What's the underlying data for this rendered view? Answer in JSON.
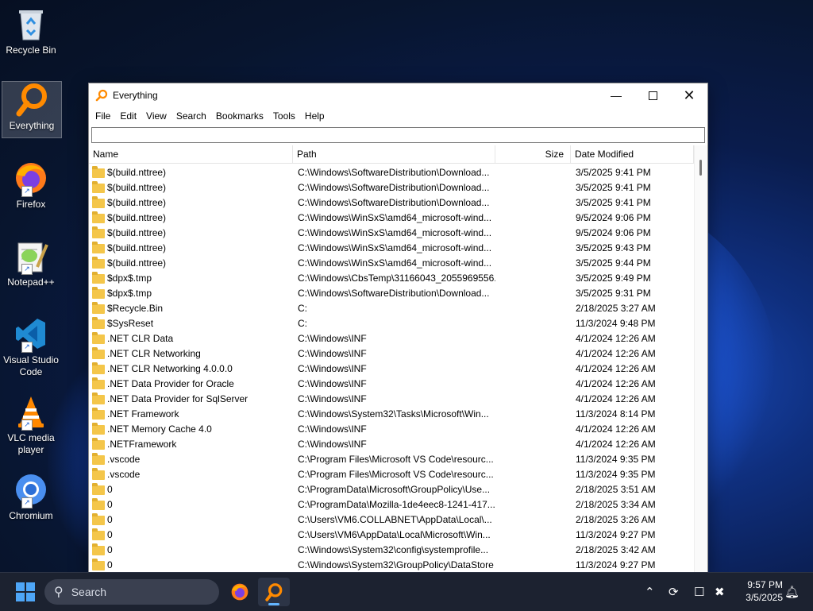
{
  "desktop": {
    "icons": [
      {
        "label": "Recycle Bin",
        "icon": "recycle-bin-icon"
      },
      {
        "label": "Everything",
        "icon": "everything-icon"
      },
      {
        "label": "Firefox",
        "icon": "firefox-icon"
      },
      {
        "label": "Notepad++",
        "icon": "notepadpp-icon"
      },
      {
        "label": "Visual Studio Code",
        "icon": "vscode-icon"
      },
      {
        "label": "VLC media player",
        "icon": "vlc-icon"
      },
      {
        "label": "Chromium",
        "icon": "chromium-icon"
      }
    ]
  },
  "window": {
    "title": "Everything",
    "menu": [
      "File",
      "Edit",
      "View",
      "Search",
      "Bookmarks",
      "Tools",
      "Help"
    ],
    "search_value": "",
    "columns": {
      "name": "Name",
      "path": "Path",
      "size": "Size",
      "date": "Date Modified"
    },
    "rows": [
      {
        "name": "$(build.nttree)",
        "path": "C:\\Windows\\SoftwareDistribution\\Download...",
        "size": "",
        "date": "3/5/2025 9:41 PM"
      },
      {
        "name": "$(build.nttree)",
        "path": "C:\\Windows\\SoftwareDistribution\\Download...",
        "size": "",
        "date": "3/5/2025 9:41 PM"
      },
      {
        "name": "$(build.nttree)",
        "path": "C:\\Windows\\SoftwareDistribution\\Download...",
        "size": "",
        "date": "3/5/2025 9:41 PM"
      },
      {
        "name": "$(build.nttree)",
        "path": "C:\\Windows\\WinSxS\\amd64_microsoft-wind...",
        "size": "",
        "date": "9/5/2024 9:06 PM"
      },
      {
        "name": "$(build.nttree)",
        "path": "C:\\Windows\\WinSxS\\amd64_microsoft-wind...",
        "size": "",
        "date": "9/5/2024 9:06 PM"
      },
      {
        "name": "$(build.nttree)",
        "path": "C:\\Windows\\WinSxS\\amd64_microsoft-wind...",
        "size": "",
        "date": "3/5/2025 9:43 PM"
      },
      {
        "name": "$(build.nttree)",
        "path": "C:\\Windows\\WinSxS\\amd64_microsoft-wind...",
        "size": "",
        "date": "3/5/2025 9:44 PM"
      },
      {
        "name": "$dpx$.tmp",
        "path": "C:\\Windows\\CbsTemp\\31166043_2055969556...",
        "size": "",
        "date": "3/5/2025 9:49 PM"
      },
      {
        "name": "$dpx$.tmp",
        "path": "C:\\Windows\\SoftwareDistribution\\Download...",
        "size": "",
        "date": "3/5/2025 9:31 PM"
      },
      {
        "name": "$Recycle.Bin",
        "path": "C:",
        "size": "",
        "date": "2/18/2025 3:27 AM"
      },
      {
        "name": "$SysReset",
        "path": "C:",
        "size": "",
        "date": "11/3/2024 9:48 PM"
      },
      {
        "name": ".NET CLR Data",
        "path": "C:\\Windows\\INF",
        "size": "",
        "date": "4/1/2024 12:26 AM"
      },
      {
        "name": ".NET CLR Networking",
        "path": "C:\\Windows\\INF",
        "size": "",
        "date": "4/1/2024 12:26 AM"
      },
      {
        "name": ".NET CLR Networking 4.0.0.0",
        "path": "C:\\Windows\\INF",
        "size": "",
        "date": "4/1/2024 12:26 AM"
      },
      {
        "name": ".NET Data Provider for Oracle",
        "path": "C:\\Windows\\INF",
        "size": "",
        "date": "4/1/2024 12:26 AM"
      },
      {
        "name": ".NET Data Provider for SqlServer",
        "path": "C:\\Windows\\INF",
        "size": "",
        "date": "4/1/2024 12:26 AM"
      },
      {
        "name": ".NET Framework",
        "path": "C:\\Windows\\System32\\Tasks\\Microsoft\\Win...",
        "size": "",
        "date": "11/3/2024 8:14 PM"
      },
      {
        "name": ".NET Memory Cache 4.0",
        "path": "C:\\Windows\\INF",
        "size": "",
        "date": "4/1/2024 12:26 AM"
      },
      {
        "name": ".NETFramework",
        "path": "C:\\Windows\\INF",
        "size": "",
        "date": "4/1/2024 12:26 AM"
      },
      {
        "name": ".vscode",
        "path": "C:\\Program Files\\Microsoft VS Code\\resourc...",
        "size": "",
        "date": "11/3/2024 9:35 PM"
      },
      {
        "name": ".vscode",
        "path": "C:\\Program Files\\Microsoft VS Code\\resourc...",
        "size": "",
        "date": "11/3/2024 9:35 PM"
      },
      {
        "name": "0",
        "path": "C:\\ProgramData\\Microsoft\\GroupPolicy\\Use...",
        "size": "",
        "date": "2/18/2025 3:51 AM"
      },
      {
        "name": "0",
        "path": "C:\\ProgramData\\Mozilla-1de4eec8-1241-417...",
        "size": "",
        "date": "2/18/2025 3:34 AM"
      },
      {
        "name": "0",
        "path": "C:\\Users\\VM6.COLLABNET\\AppData\\Local\\...",
        "size": "",
        "date": "2/18/2025 3:26 AM"
      },
      {
        "name": "0",
        "path": "C:\\Users\\VM6\\AppData\\Local\\Microsoft\\Win...",
        "size": "",
        "date": "11/3/2024 9:27 PM"
      },
      {
        "name": "0",
        "path": "C:\\Windows\\System32\\config\\systemprofile...",
        "size": "",
        "date": "2/18/2025 3:42 AM"
      },
      {
        "name": "0",
        "path": "C:\\Windows\\System32\\GroupPolicy\\DataStore",
        "size": "",
        "date": "11/3/2024 9:27 PM"
      }
    ]
  },
  "taskbar": {
    "search_label": "Search",
    "time": "9:57 PM",
    "date": "3/5/2025",
    "accent": "#63b5ff"
  }
}
